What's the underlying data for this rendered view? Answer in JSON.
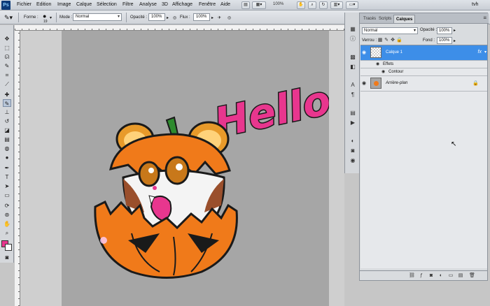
{
  "app": {
    "logo": "Ps",
    "workspace": "tvh"
  },
  "menu": [
    "Fichier",
    "Edition",
    "Image",
    "Calque",
    "Sélection",
    "Filtre",
    "Analyse",
    "3D",
    "Affichage",
    "Fenêtre",
    "Aide"
  ],
  "menubar": {
    "zoom": "100%"
  },
  "options": {
    "brush_label": "Forme :",
    "brush_size": "19",
    "mode_label": "Mode :",
    "mode_value": "Normal",
    "opacity_label": "Opacité :",
    "opacity_value": "100%",
    "flow_label": "Flux :",
    "flow_value": "100%"
  },
  "tools": [
    "move-tool",
    "marquee-tool",
    "lasso-tool",
    "quick-select-tool",
    "crop-tool",
    "eyedropper-tool",
    "healing-tool",
    "brush-tool",
    "stamp-tool",
    "history-brush-tool",
    "eraser-tool",
    "gradient-tool",
    "blur-tool",
    "dodge-tool",
    "pen-tool",
    "type-tool",
    "path-select-tool",
    "shape-tool",
    "3d-rotate-tool",
    "3d-orbit-tool",
    "hand-tool",
    "zoom-tool"
  ],
  "colors": {
    "foreground": "#e8368e",
    "background": "#ffffff",
    "layer_selected": "#3d8ee8"
  },
  "panel": {
    "tabs": [
      "Tracés",
      "Scripts",
      "Calques"
    ],
    "active_tab": "Calques",
    "blend_mode": "Normal",
    "opacity_label": "Opacité :",
    "opacity_value": "100%",
    "lock_label": "Verrou :",
    "fill_label": "Fond :",
    "fill_value": "100%",
    "layers": [
      {
        "name": "Calque 1",
        "selected": true,
        "fx": "fx"
      },
      {
        "name": "Effets",
        "type": "effects-group"
      },
      {
        "name": "Contour",
        "type": "effect"
      },
      {
        "name": "Arrière-plan",
        "locked": true
      }
    ]
  },
  "canvas": {
    "text": "Hello!"
  }
}
